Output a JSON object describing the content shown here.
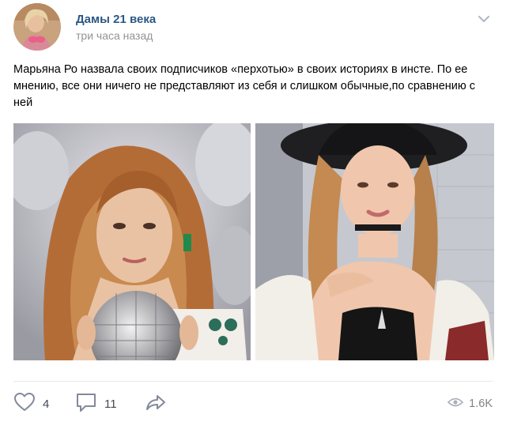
{
  "post": {
    "author": "Дамы 21 века",
    "time": "три часа назад",
    "text": "Марьяна Ро назвала своих подписчиков «перхотью» в своих историях в инсте. По ее мнению, все они ничего не представляют из себя и слишком обычные,по сравнению с ней",
    "photos": [
      {
        "subject": "girl-with-disco-ball"
      },
      {
        "subject": "girl-in-black-hat"
      }
    ]
  },
  "actions": {
    "likes": "4",
    "comments": "11",
    "views": "1.6K"
  },
  "icons": {
    "more": "more-horizontal-icon",
    "like": "heart-icon",
    "comment": "comment-icon",
    "share": "share-arrow-icon",
    "views": "eye-icon"
  },
  "colors": {
    "author_link": "#2a5885",
    "secondary_text": "#939393",
    "icon": "#828a99",
    "divider": "#e7e8ec"
  }
}
